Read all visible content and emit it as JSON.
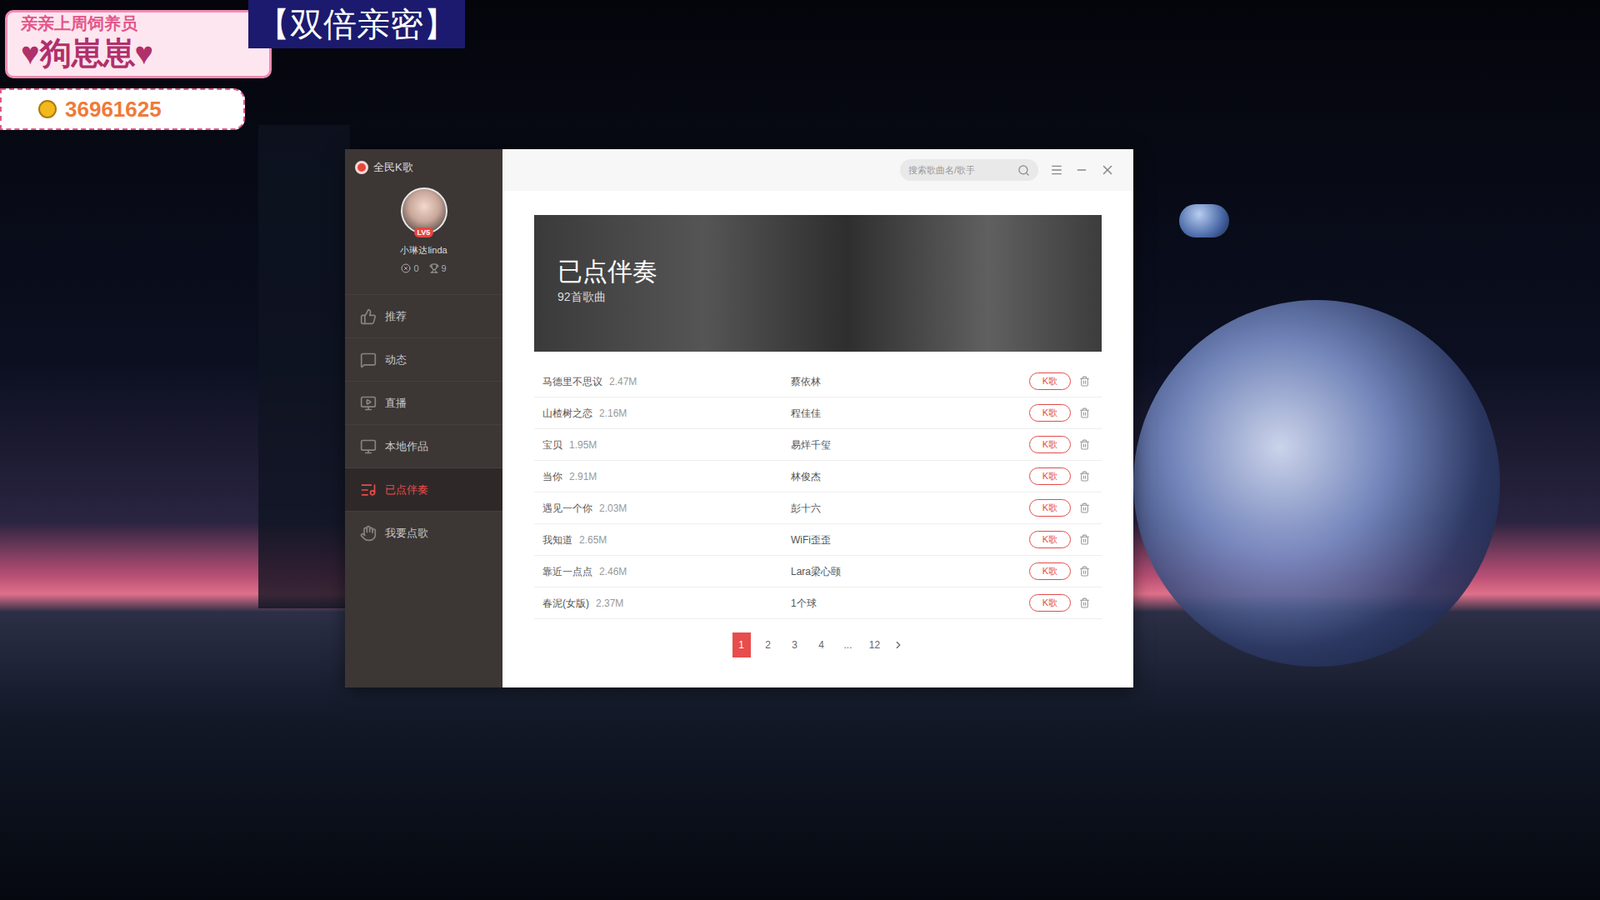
{
  "overlay": {
    "caption": "亲亲上周饲养员",
    "badge": "【双倍亲密】",
    "name": "♥狗崽崽♥",
    "id": "36961625"
  },
  "window": {
    "app_name": "全民K歌"
  },
  "profile": {
    "name": "小琳达linda",
    "level": "LV5",
    "stats": [
      {
        "value": "0"
      },
      {
        "value": "9"
      }
    ]
  },
  "sidebar": {
    "items": [
      {
        "label": "推荐",
        "selected": false
      },
      {
        "label": "动态",
        "selected": false
      },
      {
        "label": "直播",
        "selected": false
      },
      {
        "label": "本地作品",
        "selected": false
      },
      {
        "label": "已点伴奏",
        "selected": true
      },
      {
        "label": "我要点歌",
        "selected": false
      }
    ]
  },
  "search": {
    "placeholder": "搜索歌曲名/歌手"
  },
  "banner": {
    "title": "已点伴奏",
    "count": "92首歌曲"
  },
  "table": {
    "rows": [
      {
        "song": "马德里不思议",
        "size": "2.47M",
        "singer": "蔡依林",
        "action": "K歌"
      },
      {
        "song": "山楂树之恋",
        "size": "2.16M",
        "singer": "程佳佳",
        "action": "K歌"
      },
      {
        "song": "宝贝",
        "size": "1.95M",
        "singer": "易烊千玺",
        "action": "K歌"
      },
      {
        "song": "当你",
        "size": "2.91M",
        "singer": "林俊杰",
        "action": "K歌"
      },
      {
        "song": "遇见一个你",
        "size": "2.03M",
        "singer": "彭十六",
        "action": "K歌"
      },
      {
        "song": "我知道",
        "size": "2.65M",
        "singer": "WiFi歪歪",
        "action": "K歌"
      },
      {
        "song": "靠近一点点",
        "size": "2.46M",
        "singer": "Lara梁心颐",
        "action": "K歌"
      },
      {
        "song": "春泥(女版)",
        "size": "2.37M",
        "singer": "1个球",
        "action": "K歌"
      }
    ]
  },
  "pagination": {
    "pages": [
      {
        "label": "1",
        "selected": true
      },
      {
        "label": "2",
        "selected": false
      },
      {
        "label": "3",
        "selected": false
      },
      {
        "label": "4",
        "selected": false
      },
      {
        "label": "...",
        "selected": false
      },
      {
        "label": "12",
        "selected": false
      }
    ]
  }
}
